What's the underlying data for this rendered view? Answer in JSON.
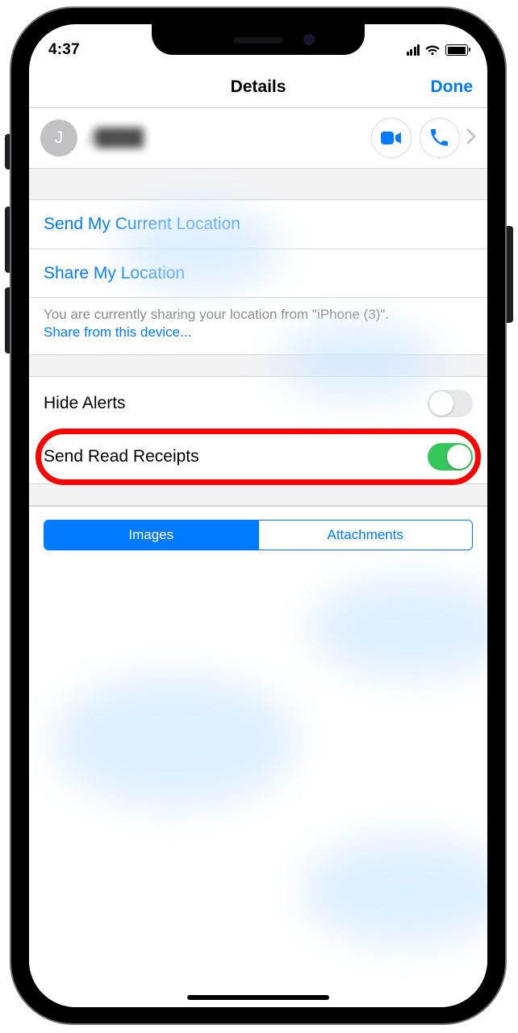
{
  "status": {
    "time": "4:37"
  },
  "nav": {
    "title": "Details",
    "done": "Done"
  },
  "contact": {
    "initial": "J",
    "name": "J████"
  },
  "location": {
    "send": "Send My Current Location",
    "share": "Share My Location",
    "note_prefix": "You are currently sharing your location from \"iPhone (3)\".",
    "note_link": "Share from this device..."
  },
  "toggles": {
    "hide_alerts": {
      "label": "Hide Alerts",
      "on": false
    },
    "read_receipts": {
      "label": "Send Read Receipts",
      "on": true
    }
  },
  "segment": {
    "images": "Images",
    "attachments": "Attachments"
  }
}
